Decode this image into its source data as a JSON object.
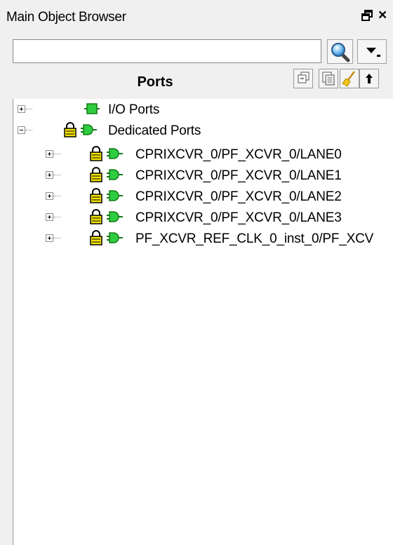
{
  "window": {
    "title": "Main Object Browser"
  },
  "search": {
    "value": "",
    "placeholder": ""
  },
  "panel": {
    "title": "Ports"
  },
  "tree": {
    "io_ports": {
      "label": "I/O Ports"
    },
    "dedicated_ports": {
      "label": "Dedicated Ports",
      "children": [
        "CPRIXCVR_0/PF_XCVR_0/LANE0",
        "CPRIXCVR_0/PF_XCVR_0/LANE1",
        "CPRIXCVR_0/PF_XCVR_0/LANE2",
        "CPRIXCVR_0/PF_XCVR_0/LANE3",
        "PF_XCVR_REF_CLK_0_inst_0/PF_XCV"
      ]
    }
  },
  "colors": {
    "port_green": "#2ecc40",
    "lock_yellow": "#f2e200"
  }
}
